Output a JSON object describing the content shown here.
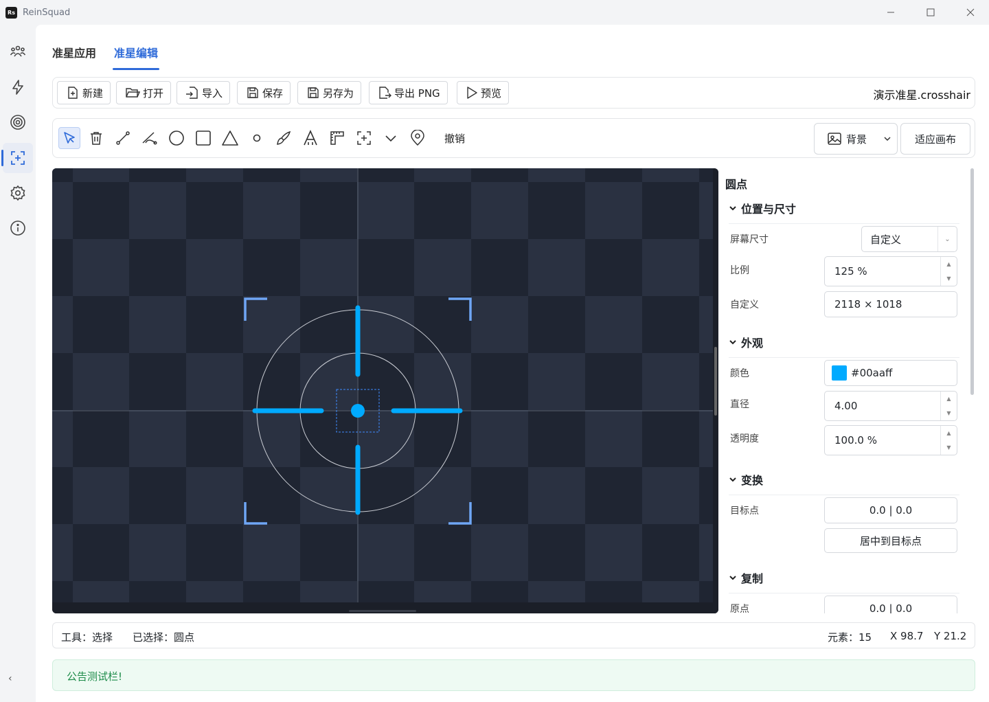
{
  "app": {
    "title": "ReinSquad",
    "logo": "Rs"
  },
  "window_controls": [
    "minimize-icon",
    "maximize-icon",
    "close-icon"
  ],
  "rail": {
    "items": [
      {
        "name": "users-icon",
        "active": false
      },
      {
        "name": "bolt-icon",
        "active": false
      },
      {
        "name": "target-icon",
        "active": false
      },
      {
        "name": "crosshair-edit-icon",
        "active": true
      },
      {
        "name": "gear-icon",
        "active": false
      },
      {
        "name": "info-icon",
        "active": false
      }
    ],
    "collapse": "‹"
  },
  "tabs": [
    {
      "label": "准星应用",
      "active": false
    },
    {
      "label": "准星编辑",
      "active": true
    }
  ],
  "file_toolbar": {
    "new": "新建",
    "open": "打开",
    "import": "导入",
    "save": "保存",
    "save_as": "另存为",
    "export_png": "导出 PNG",
    "preview": "预览",
    "filename": "演示准星.crosshair"
  },
  "draw_toolbar": {
    "tools": [
      "select-icon",
      "delete-icon",
      "line-icon",
      "arc-line-icon",
      "circle-icon",
      "rectangle-icon",
      "triangle-icon",
      "dot-icon",
      "brush-icon",
      "text-icon",
      "ruler-icon",
      "center-icon",
      "chevron-down-icon",
      "anchor-icon"
    ],
    "undo": "撤销",
    "background": "背景",
    "fit_canvas": "适应画布"
  },
  "canvas": {
    "accent": "#00aaff",
    "frame_color": "#6fa6f5",
    "background_light": "#2a3141",
    "background_dark": "#1f2532"
  },
  "properties": {
    "title": "圆点",
    "position_section": "位置与尺寸",
    "screen_size_label": "屏幕尺寸",
    "screen_size_value": "自定义",
    "scale_label": "比例",
    "scale_value": "125 %",
    "custom_label": "自定义",
    "custom_value": "2118 × 1018",
    "appearance_section": "外观",
    "color_label": "颜色",
    "color_value": "#00aaff",
    "diameter_label": "直径",
    "diameter_value": "4.00",
    "opacity_label": "透明度",
    "opacity_value": "100.0 %",
    "transform_section": "变换",
    "target_label": "目标点",
    "target_value": "0.0 | 0.0",
    "center_button": "居中到目标点",
    "copy_section": "复制",
    "origin_label": "原点",
    "origin_value": "0.0 | 0.0"
  },
  "status": {
    "tool": "工具：选择",
    "selected": "已选择：圆点",
    "elements": "元素：15",
    "x": "X 98.7",
    "y": "Y 21.2"
  },
  "notice": "公告测试栏!"
}
